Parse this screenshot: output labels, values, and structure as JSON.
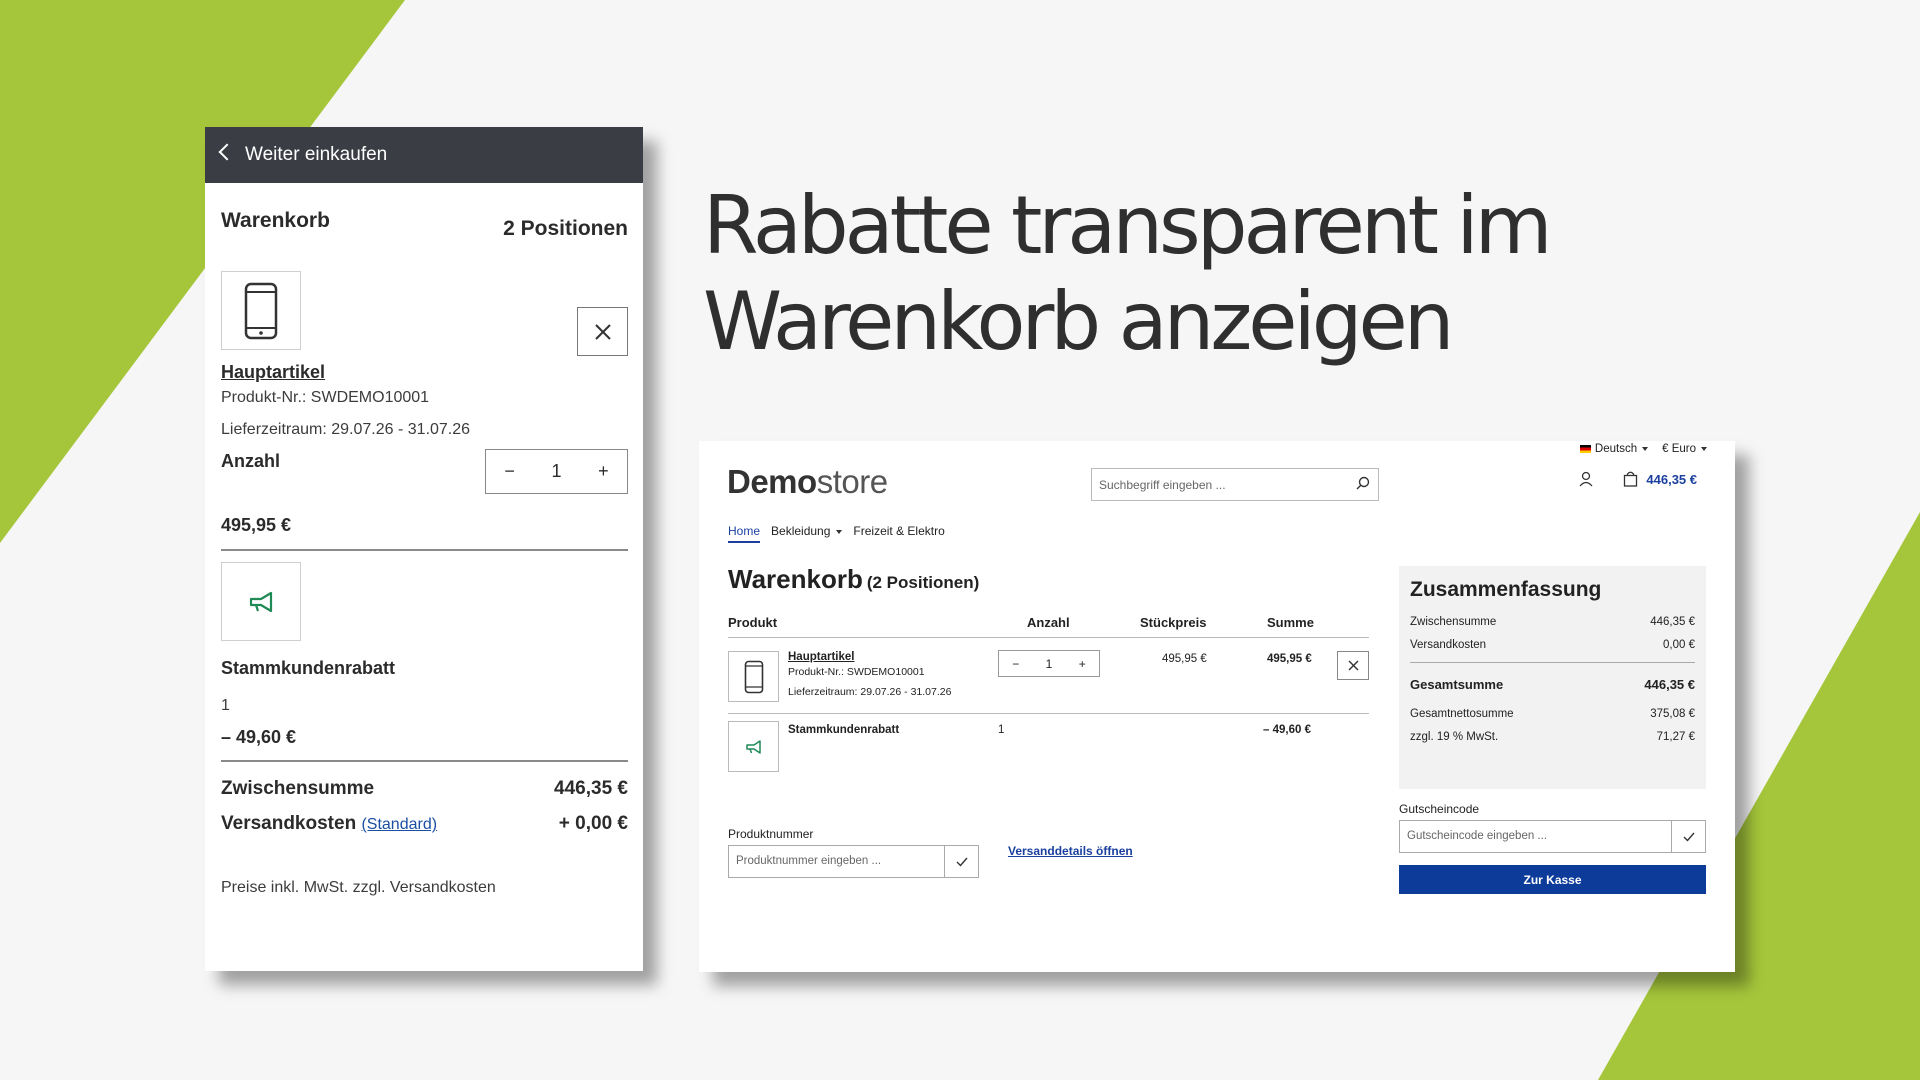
{
  "headline": {
    "line1": "Rabatte transparent im",
    "line2": "Warenkorb anzeigen"
  },
  "colors": {
    "accent_green": "#a5c63b",
    "header_dark": "#3b3d45",
    "link_blue": "#1a3f9e",
    "checkout_blue": "#0d3b9a"
  },
  "mobile": {
    "back_label": "Weiter einkaufen",
    "title": "Warenkorb",
    "count": "2 Positionen",
    "item": {
      "icon": "smartphone-icon",
      "name": "Hauptartikel",
      "product_no": "Produkt-Nr.: SWDEMO10001",
      "delivery": "Lieferzeitraum: 29.07.26 - 31.07.26",
      "qty_label": "Anzahl",
      "qty": "1",
      "price": "495,95 €"
    },
    "discount": {
      "icon": "megaphone-icon",
      "name": "Stammkundenrabatt",
      "qty": "1",
      "price": "– 49,60 €"
    },
    "subtotal_label": "Zwischensumme",
    "subtotal": "446,35 €",
    "shipping_label": "Versandkosten",
    "shipping_method": "(Standard)",
    "shipping": "+ 0,00 €",
    "note": "Preise inkl. MwSt. zzgl. Versandkosten"
  },
  "desktop": {
    "language": "Deutsch",
    "currency": "€ Euro",
    "logo_bold": "Demo",
    "logo_rest": "store",
    "search_placeholder": "Suchbegriff eingeben ...",
    "cart_total": "446,35 €",
    "nav": [
      "Home",
      "Bekleidung",
      "Freizeit & Elektro"
    ],
    "title": "Warenkorb",
    "title_count": "(2 Positionen)",
    "columns": [
      "Produkt",
      "Anzahl",
      "Stückpreis",
      "Summe"
    ],
    "item": {
      "name": "Hauptartikel",
      "product_no": "Produkt-Nr.: SWDEMO10001",
      "delivery": "Lieferzeitraum: 29.07.26 - 31.07.26",
      "qty": "1",
      "unit_price": "495,95 €",
      "total": "495,95 €"
    },
    "discount": {
      "name": "Stammkundenrabatt",
      "qty": "1",
      "total": "– 49,60 €"
    },
    "summary": {
      "title": "Zusammenfassung",
      "subtotal_label": "Zwischensumme",
      "subtotal": "446,35 €",
      "shipping_label": "Versandkosten",
      "shipping": "0,00 €",
      "total_label": "Gesamtsumme",
      "total": "446,35 €",
      "net_label": "Gesamtnettosumme",
      "net": "375,08 €",
      "vat_label": "zzgl. 19 % MwSt.",
      "vat": "71,27 €"
    },
    "voucher_label": "Gutscheincode",
    "voucher_placeholder": "Gutscheincode eingeben ...",
    "checkout_label": "Zur Kasse",
    "productno_label": "Produktnummer",
    "productno_placeholder": "Produktnummer eingeben ...",
    "shipping_details_link": "Versanddetails öffnen"
  }
}
